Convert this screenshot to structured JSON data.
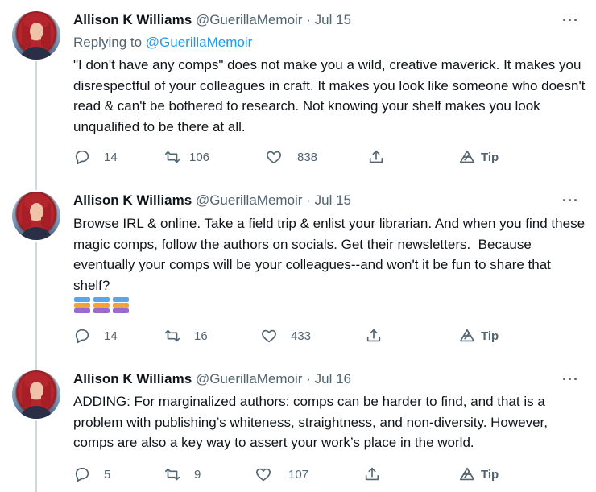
{
  "tweets": [
    {
      "name": "Allison K Williams",
      "handle": "@GuerillaMemoir",
      "separator": "·",
      "date": "Jul 15",
      "more_icon": "more-horizontal-icon",
      "replying_prefix": "Replying to",
      "replying_handle": "@GuerillaMemoir",
      "text": "\"I don't have any comps\" does not make you a wild, creative maverick. It makes you disrespectful of your colleagues in craft. It makes you look like someone who doesn't read & can't be bothered to research. Not knowing your shelf makes you look unqualified to be there at all.",
      "replies": "14",
      "retweets": "106",
      "likes": "838",
      "tip_label": "Tip"
    },
    {
      "name": "Allison K Williams",
      "handle": "@GuerillaMemoir",
      "separator": "·",
      "date": "Jul 15",
      "more_icon": "more-horizontal-icon",
      "text": "Browse IRL & online. Take a field trip & enlist your librarian. And when you find these magic comps, follow the authors on socials. Get their newsletters.  Because eventually your comps will be your colleagues--and won't it be fun to share that shelf?",
      "emoji": [
        "books-emoji",
        "books-emoji",
        "books-emoji"
      ],
      "replies": "14",
      "retweets": "16",
      "likes": "433",
      "tip_label": "Tip"
    },
    {
      "name": "Allison K Williams",
      "handle": "@GuerillaMemoir",
      "separator": "·",
      "date": "Jul 16",
      "more_icon": "more-horizontal-icon",
      "text": "ADDING: For marginalized authors: comps can be harder to find, and that is a problem with publishing’s whiteness, straightness, and non-diversity. However, comps are also a key way to assert your work’s place in the world.",
      "replies": "5",
      "retweets": "9",
      "likes": "107",
      "tip_label": "Tip"
    }
  ],
  "icons": {
    "reply": "reply-icon",
    "retweet": "retweet-icon",
    "like": "heart-icon",
    "share": "share-icon",
    "tip": "tip-icon"
  },
  "colors": {
    "link": "#1d9bf0",
    "secondary_text": "#536471",
    "primary_text": "#0f1419",
    "thread_line": "#cfd9de"
  }
}
